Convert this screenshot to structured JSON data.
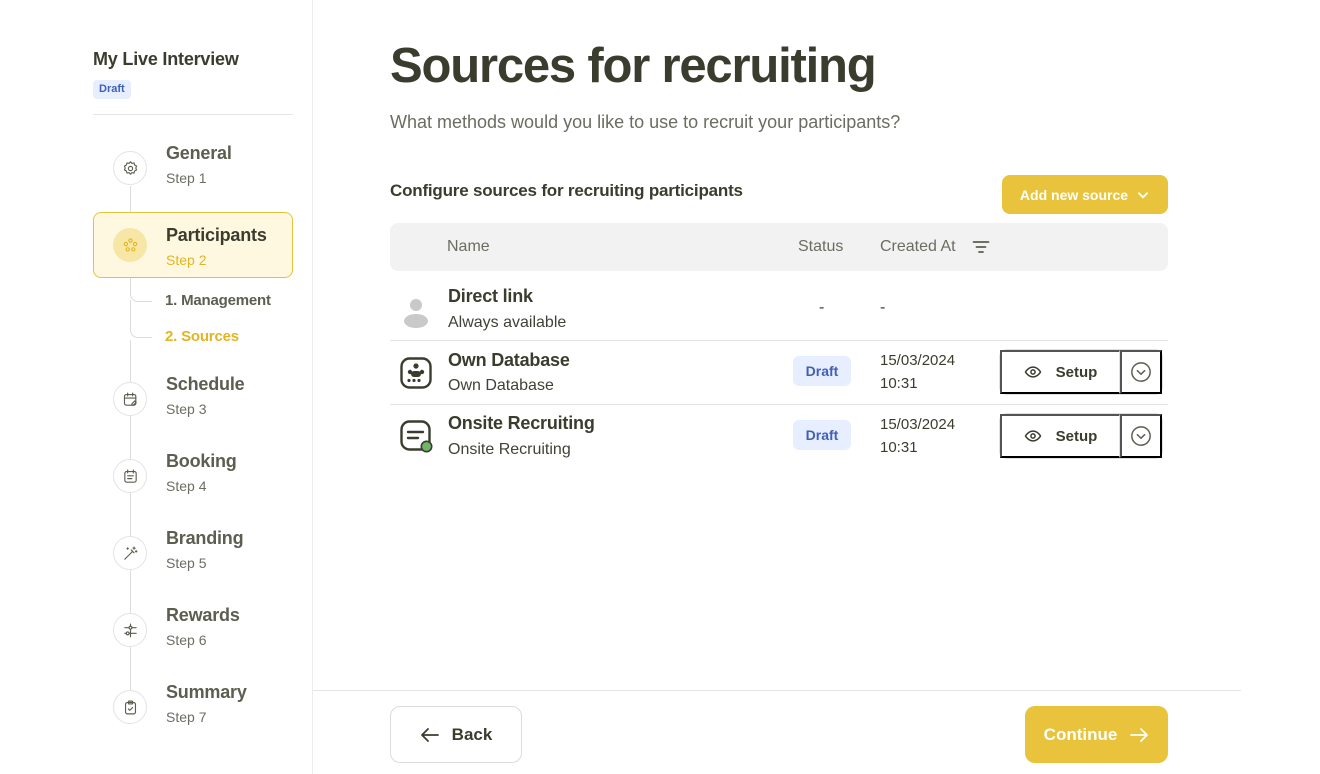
{
  "sidebar": {
    "project_title": "My Live Interview",
    "project_status": "Draft",
    "steps": [
      {
        "label": "General",
        "sub": "Step 1",
        "icon": "gear-icon"
      },
      {
        "label": "Participants",
        "sub": "Step 2",
        "icon": "participants-icon"
      },
      {
        "label": "Schedule",
        "sub": "Step 3",
        "icon": "calendar-edit-icon"
      },
      {
        "label": "Booking",
        "sub": "Step 4",
        "icon": "calendar-list-icon"
      },
      {
        "label": "Branding",
        "sub": "Step 5",
        "icon": "magic-wand-icon"
      },
      {
        "label": "Rewards",
        "sub": "Step 6",
        "icon": "sliders-icon"
      },
      {
        "label": "Summary",
        "sub": "Step 7",
        "icon": "clipboard-check-icon"
      }
    ],
    "substeps": [
      {
        "label": "1. Management"
      },
      {
        "label": "2. Sources"
      }
    ]
  },
  "main": {
    "title": "Sources for recruiting",
    "subtitle": "What methods would you like to use to recruit your participants?",
    "section_title": "Configure sources for recruiting participants",
    "add_source_label": "Add new source",
    "table": {
      "headers": {
        "name": "Name",
        "status": "Status",
        "created_at": "Created At"
      },
      "rows": [
        {
          "name": "Direct link",
          "desc": "Always available",
          "status": "-",
          "created": "-",
          "icon": "person-icon"
        },
        {
          "name": "Own Database",
          "desc": "Own Database",
          "status": "Draft",
          "created_date": "15/03/2024",
          "created_time": "10:31",
          "setup_label": "Setup",
          "icon": "database-icon"
        },
        {
          "name": "Onsite Recruiting",
          "desc": "Onsite Recruiting",
          "status": "Draft",
          "created_date": "15/03/2024",
          "created_time": "10:31",
          "setup_label": "Setup",
          "icon": "onsite-form-icon"
        }
      ]
    }
  },
  "footer": {
    "back_label": "Back",
    "continue_label": "Continue"
  },
  "colors": {
    "accent": "#e9c33b",
    "accent_text": "#e2b523",
    "draft_bg": "#e6eeff",
    "draft_text": "#3f5fb8",
    "text_dark": "#3a3d2e",
    "online_dot": "#6fb56a"
  }
}
